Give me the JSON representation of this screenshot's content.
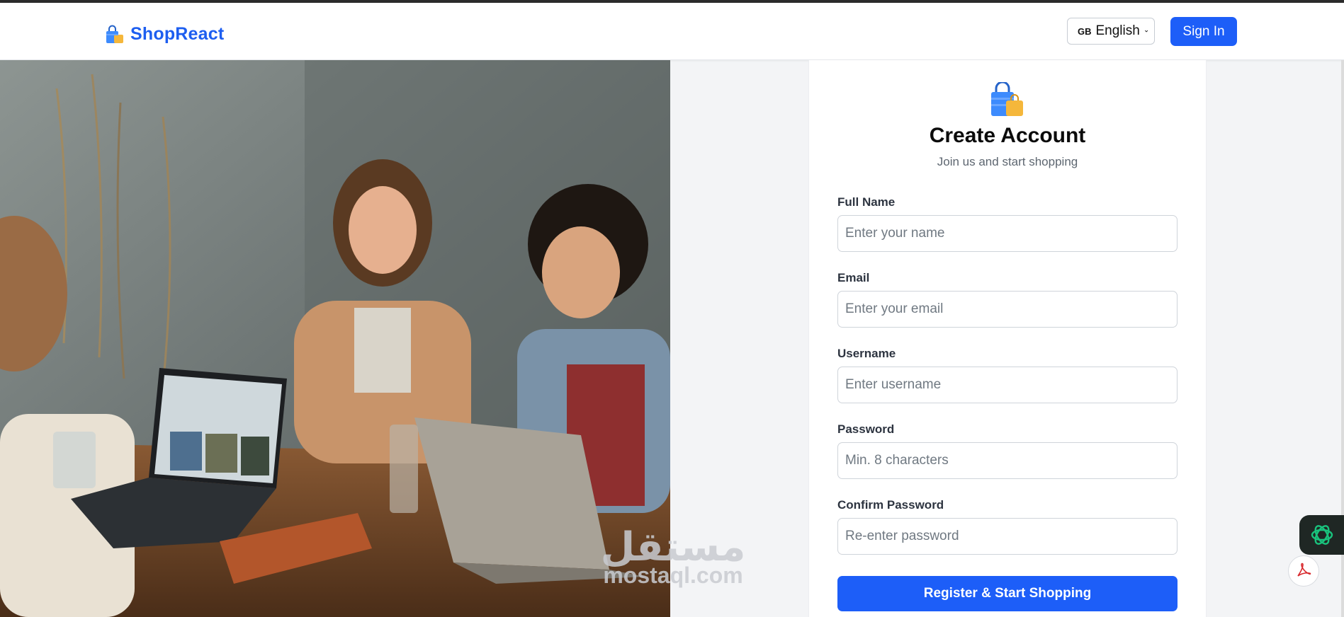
{
  "header": {
    "brand": "ShopReact",
    "language": {
      "flag": "GB",
      "selected": "English"
    },
    "signin_label": "Sign In"
  },
  "hero": {
    "icon": "hero-photo"
  },
  "form": {
    "title": "Create Account",
    "subtitle": "Join us and start shopping",
    "fields": [
      {
        "label": "Full Name",
        "placeholder": "Enter your name"
      },
      {
        "label": "Email",
        "placeholder": "Enter your email"
      },
      {
        "label": "Username",
        "placeholder": "Enter username"
      },
      {
        "label": "Password",
        "placeholder": "Min. 8 characters"
      },
      {
        "label": "Confirm Password",
        "placeholder": "Re-enter password"
      }
    ],
    "submit_label": "Register & Start Shopping"
  },
  "watermark": {
    "arabic": "مستقل",
    "latin": "mostaql.com"
  },
  "colors": {
    "brand": "#1d5ef0",
    "primary_button": "#1d5ef8",
    "page_bg": "#f3f4f6"
  }
}
